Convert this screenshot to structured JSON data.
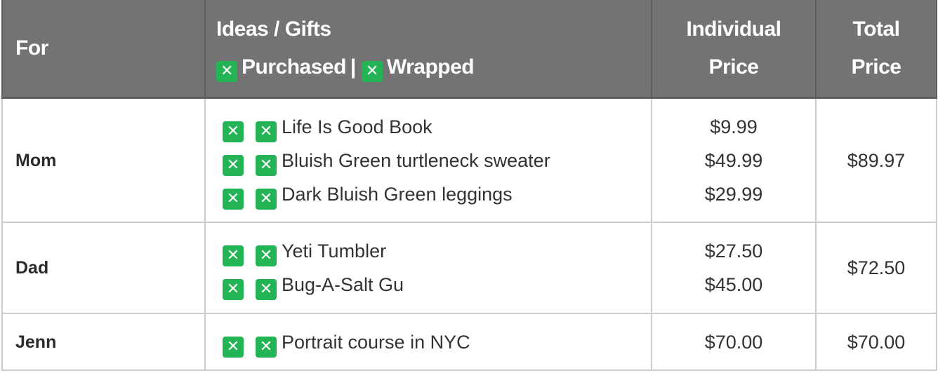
{
  "header": {
    "for": "For",
    "ideas_title": "Ideas / Gifts",
    "legend": {
      "purchased_icon": "x-checkbox-icon",
      "purchased": "Purchased",
      "separator": "|",
      "wrapped_icon": "x-checkbox-icon",
      "wrapped": "Wrapped"
    },
    "individual_price": [
      "Individual",
      "Price"
    ],
    "total_price": [
      "Total",
      "Price"
    ]
  },
  "checkbox_glyph": "✕",
  "colors": {
    "header_bg": "#737373",
    "checkbox_green": "#22b455",
    "border": "#cccccc"
  },
  "rows": [
    {
      "for": "Mom",
      "items": [
        {
          "name": "Life Is Good Book",
          "price": "$9.99",
          "purchased": true,
          "wrapped": true
        },
        {
          "name": "Bluish Green turtleneck sweater",
          "price": "$49.99",
          "purchased": true,
          "wrapped": true
        },
        {
          "name": "Dark Bluish Green leggings",
          "price": "$29.99",
          "purchased": true,
          "wrapped": true
        }
      ],
      "total": "$89.97"
    },
    {
      "for": "Dad",
      "items": [
        {
          "name": "Yeti Tumbler",
          "price": "$27.50",
          "purchased": true,
          "wrapped": true
        },
        {
          "name": "Bug-A-Salt Gu",
          "price": "$45.00",
          "purchased": true,
          "wrapped": true
        }
      ],
      "total": "$72.50"
    },
    {
      "for": "Jenn",
      "items": [
        {
          "name": "Portrait course in NYC",
          "price": "$70.00",
          "purchased": true,
          "wrapped": true
        }
      ],
      "total": "$70.00"
    }
  ]
}
